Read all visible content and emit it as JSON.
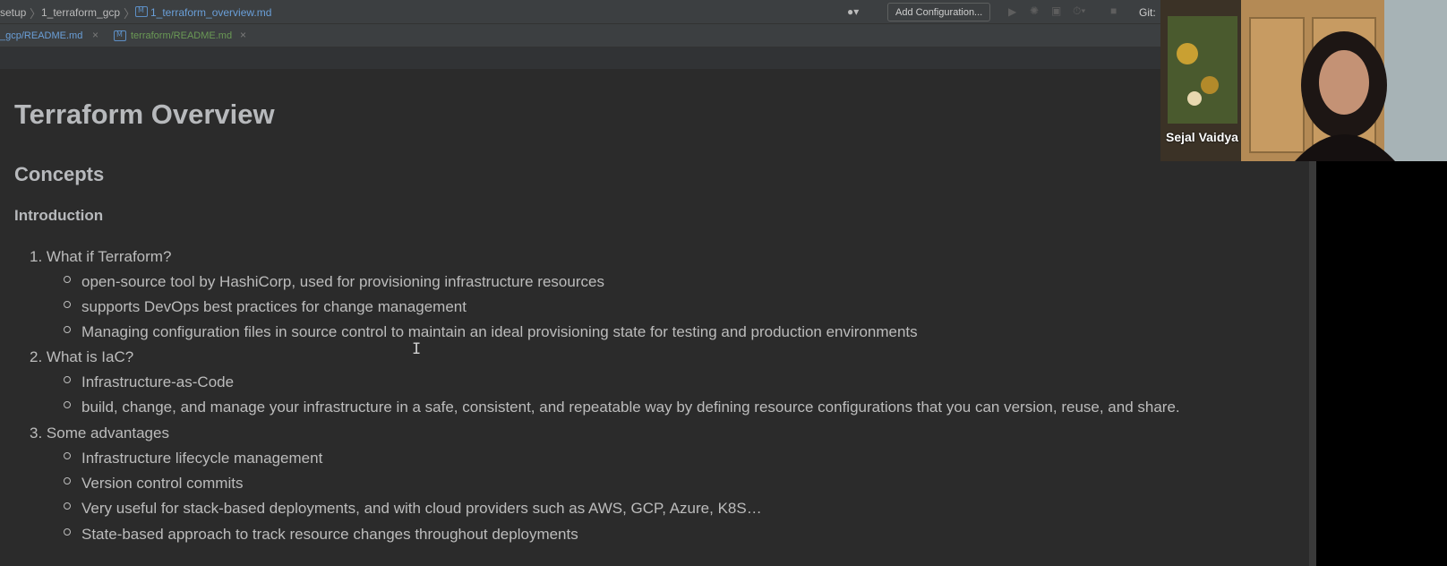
{
  "navbar": {
    "crumbs": [
      "setup",
      "1_terraform_gcp",
      "1_terraform_overview.md"
    ],
    "add_configuration": "Add Configuration...",
    "git_label": "Git:"
  },
  "tabs": [
    {
      "label": "_gcp/README.md"
    },
    {
      "label": "terraform/README.md"
    }
  ],
  "doc": {
    "title": "Terraform Overview",
    "section": "Concepts",
    "subsection": "Introduction",
    "items": [
      {
        "label": "1. What if Terraform?",
        "bullets": [
          "open-source tool by HashiCorp, used for provisioning infrastructure resources",
          "supports DevOps best practices for change management",
          "Managing configuration files in source control to maintain an ideal provisioning state for testing and production environments"
        ]
      },
      {
        "label": "2. What is IaC?",
        "bullets": [
          "Infrastructure-as-Code",
          "build, change, and manage your infrastructure in a safe, consistent, and repeatable way by defining resource configurations that you can version, reuse, and share."
        ]
      },
      {
        "label": "3. Some advantages",
        "bullets": [
          "Infrastructure lifecycle management",
          "Version control commits",
          "Very useful for stack-based deployments, and with cloud providers such as AWS, GCP, Azure, K8S…",
          "State-based approach to track resource changes throughout deployments"
        ]
      }
    ]
  },
  "video": {
    "participant_name": "Sejal Vaidya"
  },
  "colors": {
    "bg": "#2b2b2b",
    "text": "#bcbcbc",
    "link": "#6a9fd8",
    "green": "#6a9955"
  }
}
